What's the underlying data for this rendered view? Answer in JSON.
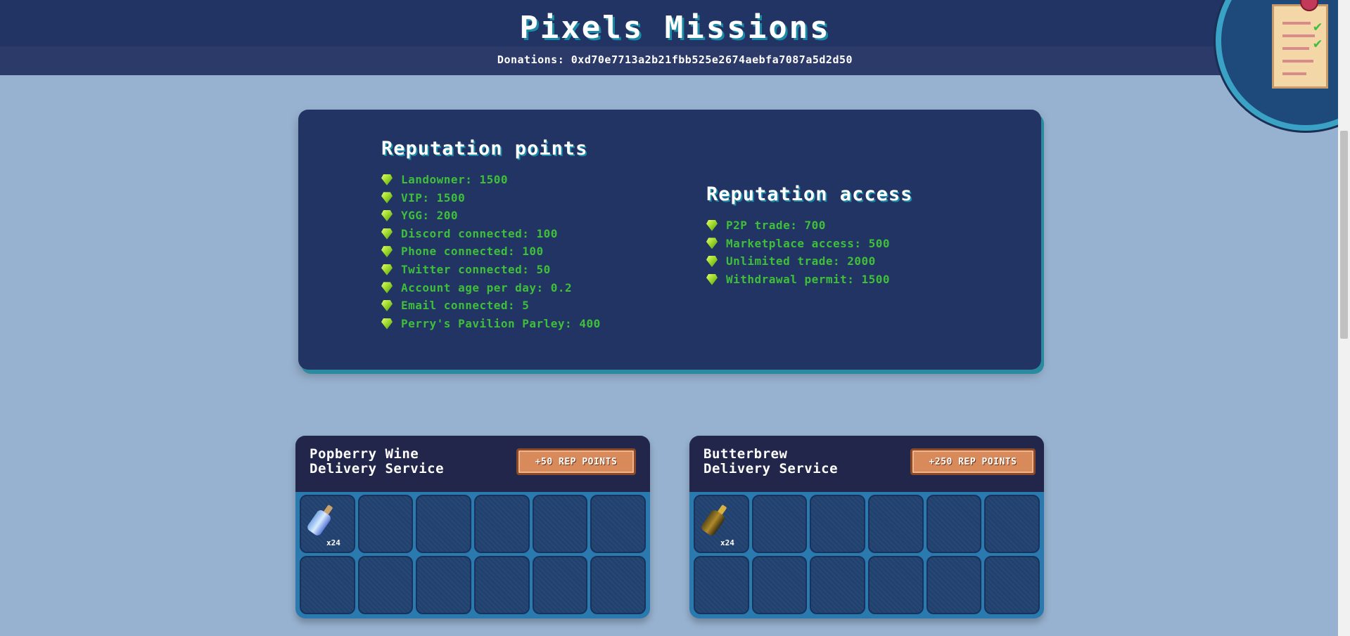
{
  "header": {
    "title": "Pixels Missions",
    "donations": "Donations: 0xd70e7713a2b21fbb525e2674aebfa7087a5d2d50"
  },
  "reputation_points": {
    "heading": "Reputation points",
    "items": [
      "Landowner: 1500",
      "VIP: 1500",
      "YGG: 200",
      "Discord connected: 100",
      "Phone connected: 100",
      "Twitter connected: 50",
      "Account age per day: 0.2",
      "Email connected: 5",
      "Perry's Pavilion Parley: 400"
    ]
  },
  "reputation_access": {
    "heading": "Reputation access",
    "items": [
      "P2P trade: 700",
      "Marketplace access: 500",
      "Unlimited trade: 2000",
      "Withdrawal permit: 1500"
    ]
  },
  "missions": [
    {
      "title_line1": "Popberry Wine",
      "title_line2": "Delivery Service",
      "reward": "+50 REP POINTS",
      "item_icon": "popberry-wine-bottle-icon",
      "item_qty": "x24"
    },
    {
      "title_line1": "Butterbrew",
      "title_line2": "Delivery Service",
      "reward": "+250 REP POINTS",
      "item_icon": "butterbrew-bottle-icon",
      "item_qty": "x24"
    }
  ],
  "colors": {
    "page_bg": "#97b2d0",
    "header_bg": "#213463",
    "panel_bg": "#213463",
    "rep_text": "#3fbf3a",
    "reward_button": "#d98a5a"
  }
}
